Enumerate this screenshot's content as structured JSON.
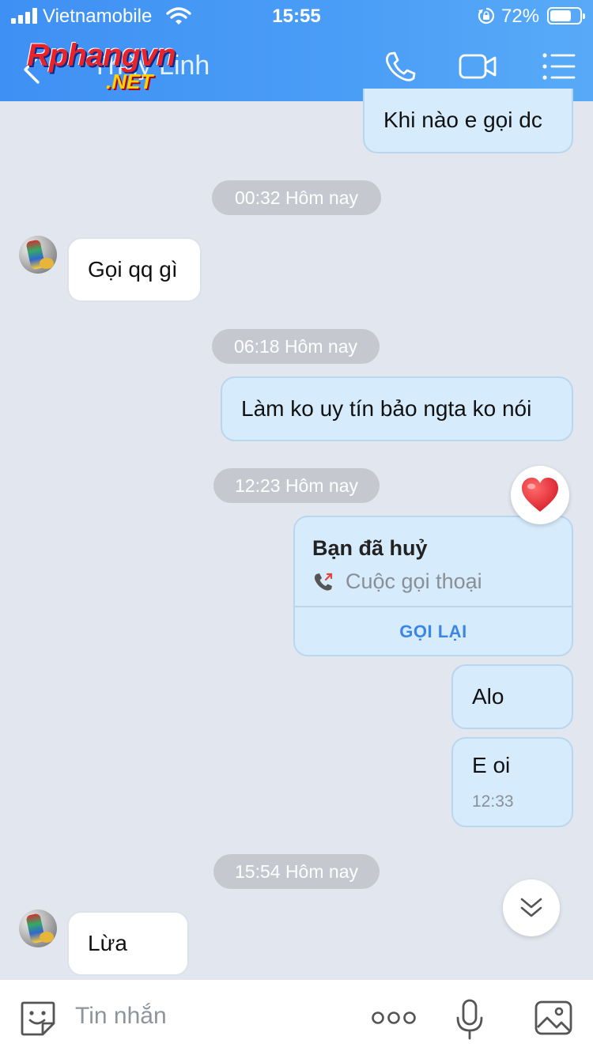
{
  "status_bar": {
    "carrier": "Vietnamobile",
    "time": "15:55",
    "battery_percent": "72%",
    "battery_level": 0.72,
    "icons": [
      "signal-icon",
      "wifi-icon",
      "rotation-lock-icon",
      "battery-icon"
    ]
  },
  "header": {
    "contact_name": "Thùy Linh",
    "watermark_top": "Rphangvn",
    "watermark_bottom": ".NET",
    "icons": [
      "back-chevron-icon",
      "phone-icon",
      "video-camera-icon",
      "menu-list-icon"
    ],
    "accent_color": "#4b9ef6"
  },
  "messages": {
    "m1": "Khi nào e gọi dc",
    "t1": "00:32 Hôm nay",
    "m2": "Gọi qq gì",
    "t2": "06:18 Hôm nay",
    "m3": "Làm ko uy tín bảo ngta ko nói",
    "t3": "12:23 Hôm nay",
    "call_card": {
      "title": "Bạn đã huỷ",
      "subtitle": "Cuộc gọi thoại",
      "button": "GỌI LẠI",
      "reaction": "heart-icon"
    },
    "m4": "Alo",
    "m5": "E oi",
    "m5_time": "12:33",
    "t4": "15:54 Hôm nay",
    "m6": "Lừa"
  },
  "input_bar": {
    "placeholder": "Tin nhắn",
    "icons": [
      "emoji-sticker-icon",
      "more-dots-icon",
      "microphone-icon",
      "image-gallery-icon"
    ]
  },
  "colors": {
    "outgoing_bubble": "#d6ebfb",
    "incoming_bubble": "#ffffff",
    "chat_background": "#e2e6ee",
    "link_blue": "#3a86e8"
  }
}
